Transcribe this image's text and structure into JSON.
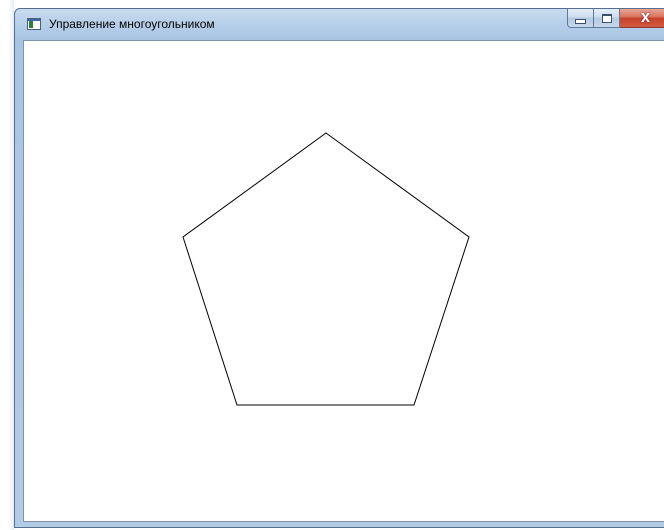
{
  "window": {
    "title": "Управление многоугольником",
    "icon": "app-window-icon",
    "buttons": {
      "minimize_icon": "minimize-icon",
      "maximize_icon": "maximize-icon",
      "close_icon": "close-icon",
      "close_glyph": "X"
    }
  },
  "canvas": {
    "shape": "pentagon",
    "sides": 5,
    "fill": "#ffffff",
    "stroke": "#000000"
  },
  "colors": {
    "titlebar": "#b9d0ea",
    "close_button": "#c7412b",
    "canvas_background": "#ffffff"
  }
}
